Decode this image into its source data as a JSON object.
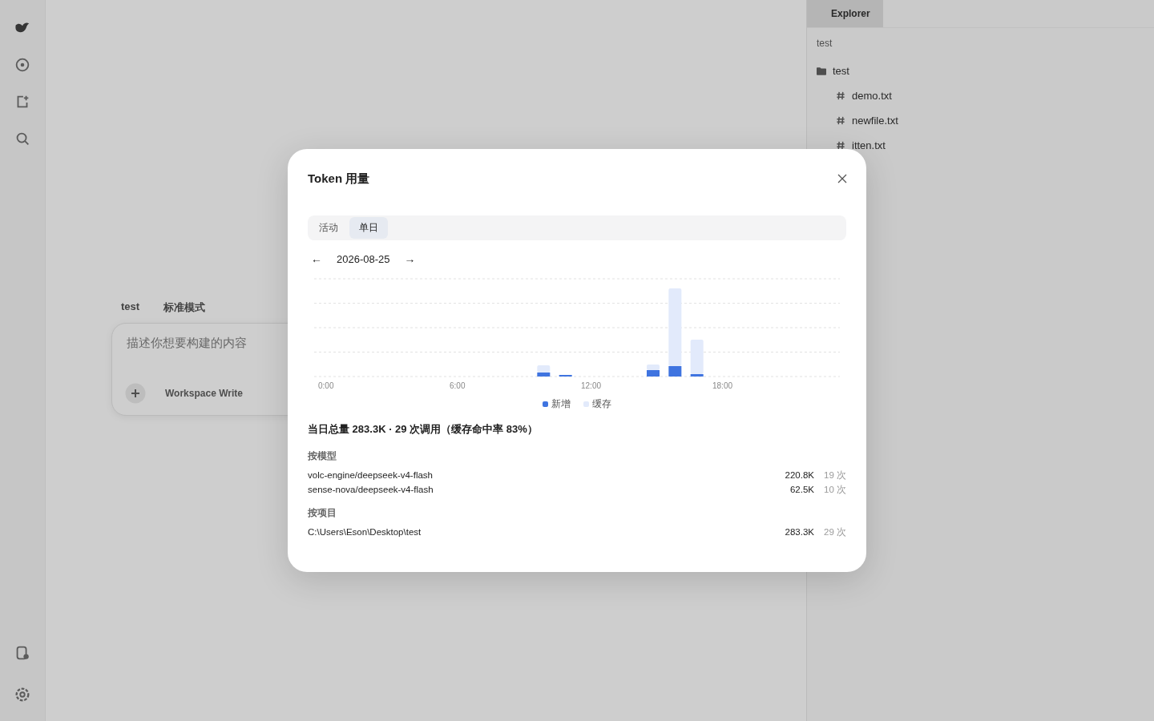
{
  "sidebar": {
    "items": [
      {
        "kind": "logo"
      },
      {
        "kind": "new"
      },
      {
        "kind": "add"
      },
      {
        "kind": "search"
      }
    ],
    "bottom_items": [
      {
        "kind": "database"
      },
      {
        "kind": "settings"
      }
    ]
  },
  "composer": {
    "project": "test",
    "mode": "标准模式",
    "placeholder": "描述你想要构建的内容",
    "permission": "Workspace Write"
  },
  "explorer": {
    "tabs": [
      {
        "label": "Explorer",
        "selected": true
      }
    ],
    "path": "test",
    "tree": [
      {
        "name": "test",
        "kind": "folder",
        "children": [
          {
            "name": "demo.txt",
            "kind": "file"
          },
          {
            "name": "newfile.txt",
            "kind": "file"
          },
          {
            "name": "itten.txt",
            "kind": "file"
          }
        ]
      }
    ]
  },
  "dialog": {
    "title": "Token 用量",
    "tabs": [
      {
        "label": "活动",
        "selected": false
      },
      {
        "label": "单日",
        "selected": true
      }
    ],
    "prev": "←",
    "date": "2026-08-25",
    "next": "→",
    "chart": {
      "x_labels": [
        "0:00",
        "6:00",
        "12:00",
        "18:00"
      ],
      "legend": [
        {
          "label": "新增",
          "color": "#3f74e0"
        },
        {
          "label": "缓存",
          "color": "#e2eafb"
        }
      ]
    },
    "summary": "当日总量 283.3K · 29 次调用（缓存命中率 83%）",
    "sections": [
      {
        "title": "按模型",
        "rows": [
          {
            "name": "volc-engine/deepseek-v4-flash",
            "tokens": "220.8K",
            "calls": "19 次"
          },
          {
            "name": "sense-nova/deepseek-v4-flash",
            "tokens": "62.5K",
            "calls": "10 次"
          }
        ]
      },
      {
        "title": "按项目",
        "rows": [
          {
            "name": "C:\\Users\\Eson\\Desktop\\test",
            "tokens": "283.3K",
            "calls": "29 次"
          }
        ]
      }
    ]
  }
}
